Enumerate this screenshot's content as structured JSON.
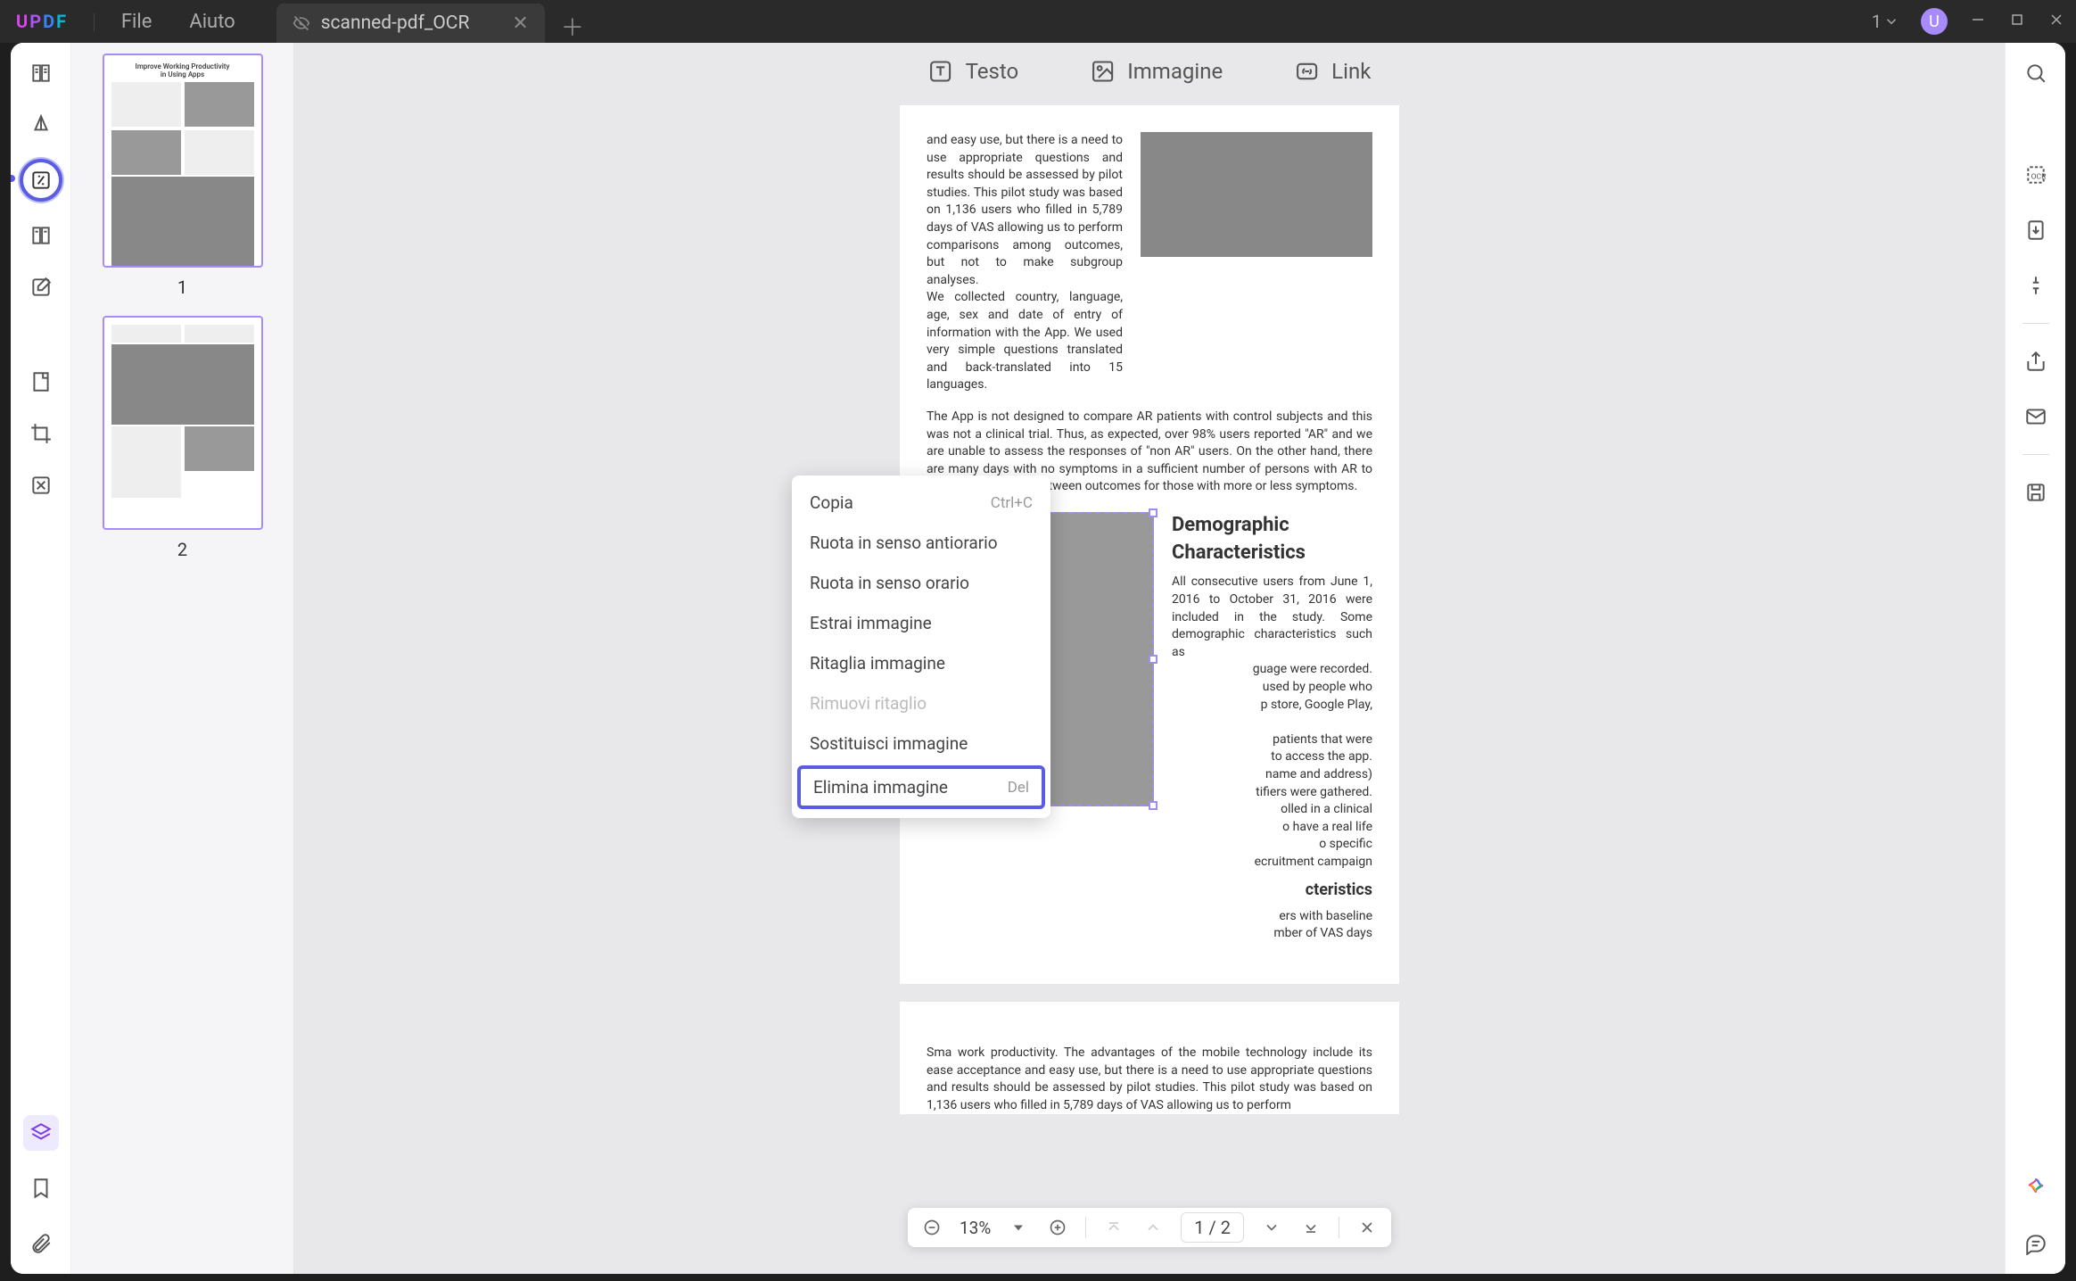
{
  "app": {
    "logo_chars": [
      "U",
      "P",
      "D",
      "F"
    ]
  },
  "menubar": {
    "file": "File",
    "aiuto": "Aiuto"
  },
  "tab": {
    "name": "scanned-pdf_OCR"
  },
  "titlebar": {
    "page_indicator": "1",
    "avatar_initial": "U"
  },
  "top_tabs": {
    "testo": "Testo",
    "immagine": "Immagine",
    "link": "Link"
  },
  "thumbnails": {
    "p1_title1": "Improve Working Productivity",
    "p1_title2": "in Using Apps",
    "n1": "1",
    "n2": "2"
  },
  "document": {
    "para1": "and easy use, but there is a need to use appropriate questions and results should be assessed by pilot studies. This pilot study was based on 1,136 users who filled in 5,789 days of VAS allowing us to perform comparisons among outcomes, but not to make subgroup analyses.",
    "para1b": "We collected country, language, age, sex and date of entry of information with the App. We used very simple questions translated and back-translated into 15 languages.",
    "para2": "The App is not designed to compare AR patients with control subjects and this was not a clinical trial. Thus, as expected, over 98% users reported \"AR\" and we are unable to assess the responses of \"non AR\" users. On the other hand, there are many days with no symptoms in a sufficient number of persons with AR to allow comparisons between outcomes for those with more or less symptoms.",
    "demo_title": "Demographic Characteristics",
    "demo_para1": "All consecutive users from June 1, 2016 to October 31, 2016 were included in the study. Some demographic characteristics such as",
    "demo_para2": "guage were recorded.",
    "demo_para3": "used by people who",
    "demo_para4": "p store, Google Play,",
    "demo_para5": "patients that were",
    "demo_para6": "to access the app.",
    "demo_para7": "name and address)",
    "demo_para8": "tifiers were gathered.",
    "demo_para9": "olled in a clinical",
    "demo_para10": "o have a real life",
    "demo_para11": "o specific",
    "demo_para12": "ecruitment campaign",
    "baseline_title": "cteristics",
    "baseline_para1": "ers with baseline",
    "baseline_para2": "mber of VAS days",
    "page2_para": "Sma  work productivity. The advantages of the mobile technology include its ease acceptance and easy use, but there is a need to use appropriate questions and results should be assessed by pilot studies. This pilot study was based on 1,136 users who filled in 5,789 days of VAS allowing us to perform"
  },
  "context_menu": {
    "copy": "Copia",
    "copy_shortcut": "Ctrl+C",
    "rotate_ccw": "Ruota in senso antiorario",
    "rotate_cw": "Ruota in senso orario",
    "extract": "Estrai immagine",
    "crop": "Ritaglia immagine",
    "remove_crop": "Rimuovi ritaglio",
    "replace": "Sostituisci immagine",
    "delete": "Elimina immagine",
    "delete_shortcut": "Del"
  },
  "zoom_bar": {
    "zoom": "13%",
    "page_cur": "1",
    "page_sep": "/",
    "page_total": "2"
  }
}
